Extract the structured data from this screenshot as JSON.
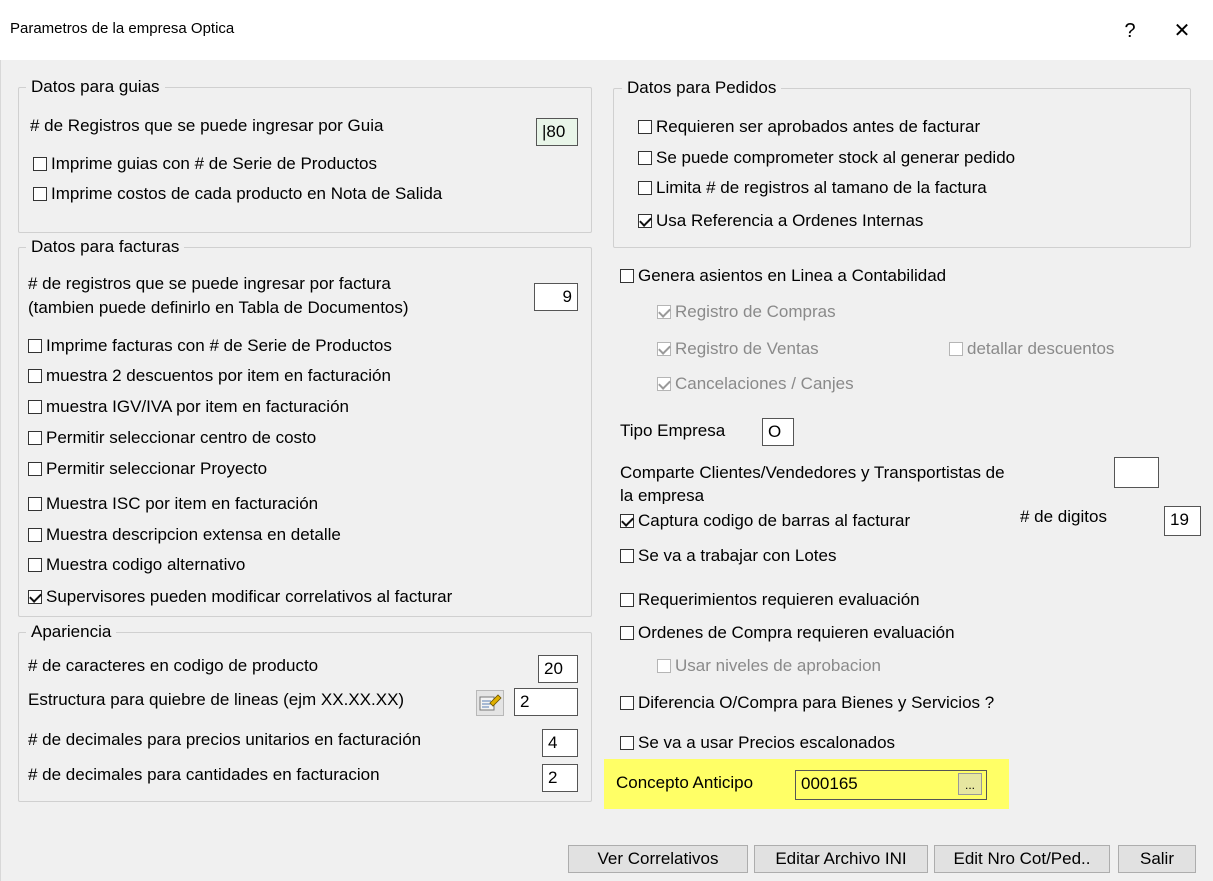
{
  "window": {
    "title": "Parametros de la empresa Optica",
    "help_label": "?",
    "close_label": "✕"
  },
  "guias": {
    "legend": "Datos para guias",
    "registros_label": "# de Registros que se puede ingresar por Guia",
    "registros_value": "|80",
    "series_label": "Imprime guias con # de Serie de Productos",
    "costos_label": "Imprime costos de cada producto en Nota de Salida"
  },
  "facturas": {
    "legend": "Datos para facturas",
    "registros_label_1": "# de registros que se puede ingresar por factura",
    "registros_label_2": "(tambien puede definirlo en Tabla de Documentos)",
    "registros_value": "9",
    "options": [
      "Imprime facturas con # de Serie de Productos",
      "muestra 2 descuentos por item en facturación",
      "muestra IGV/IVA por item en facturación",
      "Permitir seleccionar centro de costo",
      "Permitir seleccionar Proyecto",
      "Muestra ISC por item en facturación",
      "Muestra descripcion extensa en detalle",
      "Muestra codigo alternativo",
      "Supervisores pueden modificar correlativos al facturar"
    ]
  },
  "apariencia": {
    "legend": "Apariencia",
    "caracteres_label": "# de caracteres en codigo de producto",
    "caracteres_value": "20",
    "estructura_label": "Estructura para quiebre de lineas (ejm XX.XX.XX)",
    "estructura_value": "2",
    "dec_precios_label": "# de decimales para precios unitarios en facturación",
    "dec_precios_value": "4",
    "dec_cant_label": "# de decimales para cantidades en facturacion",
    "dec_cant_value": "2"
  },
  "pedidos": {
    "legend": "Datos para Pedidos",
    "options": [
      "Requieren ser aprobados antes de facturar",
      "Se puede comprometer stock al generar pedido",
      "Limita # de registros al tamano de la factura",
      "Usa Referencia a Ordenes Internas"
    ]
  },
  "contabilidad": {
    "genera_label": "Genera asientos en Linea a Contabilidad",
    "compras_label": "Registro de Compras",
    "ventas_label": "Registro de Ventas",
    "descuentos_label": "detallar descuentos",
    "cancelaciones_label": "Cancelaciones / Canjes"
  },
  "empresa": {
    "tipo_label": "Tipo Empresa",
    "tipo_value": "O",
    "comparte_label_1": "Comparte Clientes/Vendedores y Transportistas  de",
    "comparte_label_2": "la empresa",
    "comparte_value": ""
  },
  "otros": {
    "barras_label": "Captura codigo de barras al facturar",
    "digitos_label": "# de digitos",
    "digitos_value": "19",
    "lotes_label": "Se va a trabajar con Lotes",
    "requerimientos_label": "Requerimientos requieren evaluación",
    "ordenes_label": "Ordenes de Compra requieren evaluación",
    "niveles_label": "Usar niveles de aprobacion",
    "diferencia_label": "Diferencia O/Compra para Bienes y Servicios ?",
    "precios_label": "Se va a usar Precios escalonados"
  },
  "anticipo": {
    "label": "Concepto Anticipo",
    "value": "000165",
    "browse_label": "...",
    "highlight_color": "#ffff66"
  },
  "buttons": {
    "correlativos": "Ver Correlativos",
    "ini": "Editar Archivo INI",
    "cot_ped": "Edit Nro Cot/Ped..",
    "salir": "Salir"
  }
}
